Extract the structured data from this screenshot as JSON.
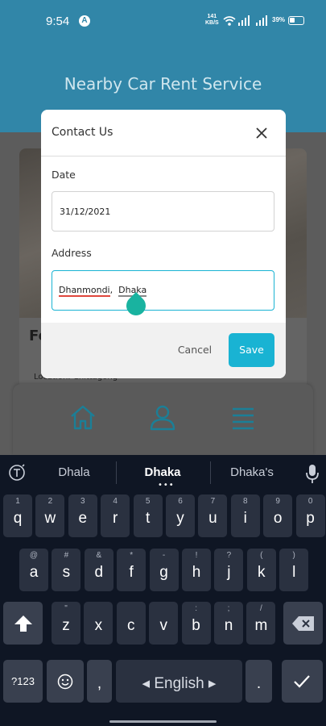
{
  "status_bar": {
    "time": "9:54",
    "app_icon_letter": "A",
    "net_speed_value": "141",
    "net_speed_unit": "KB/S",
    "battery": "39%"
  },
  "app": {
    "title": "Nearby Car Rent Service",
    "card_title": "Fe",
    "card_location": "Location: Chittagong"
  },
  "dialog": {
    "title": "Contact Us",
    "date_label": "Date",
    "date_value": "31/12/2021",
    "address_label": "Address",
    "address_word1": "Dhanmondi",
    "address_sep": ",  ",
    "address_word2": "Dhaka",
    "cancel_label": "Cancel",
    "save_label": "Save"
  },
  "keyboard": {
    "suggestions": [
      "Dhala",
      "Dhaka",
      "Dhaka's"
    ],
    "row1": [
      {
        "k": "q",
        "s": "1"
      },
      {
        "k": "w",
        "s": "2"
      },
      {
        "k": "e",
        "s": "3"
      },
      {
        "k": "r",
        "s": "4"
      },
      {
        "k": "t",
        "s": "5"
      },
      {
        "k": "y",
        "s": "6"
      },
      {
        "k": "u",
        "s": "7"
      },
      {
        "k": "i",
        "s": "8"
      },
      {
        "k": "o",
        "s": "9"
      },
      {
        "k": "p",
        "s": "0"
      }
    ],
    "row2": [
      {
        "k": "a",
        "s": "@"
      },
      {
        "k": "s",
        "s": "#"
      },
      {
        "k": "d",
        "s": "&"
      },
      {
        "k": "f",
        "s": "*"
      },
      {
        "k": "g",
        "s": "-"
      },
      {
        "k": "h",
        "s": "!"
      },
      {
        "k": "j",
        "s": "?"
      },
      {
        "k": "k",
        "s": "("
      },
      {
        "k": "l",
        "s": ")"
      }
    ],
    "row3": [
      {
        "k": "z",
        "s": "\""
      },
      {
        "k": "x",
        "s": ""
      },
      {
        "k": "c",
        "s": ""
      },
      {
        "k": "v",
        "s": ""
      },
      {
        "k": "b",
        "s": ":"
      },
      {
        "k": "n",
        "s": ";"
      },
      {
        "k": "m",
        "s": "/"
      }
    ],
    "symbols_label": "?123",
    "comma": ",",
    "space_label": "English",
    "period": "."
  }
}
